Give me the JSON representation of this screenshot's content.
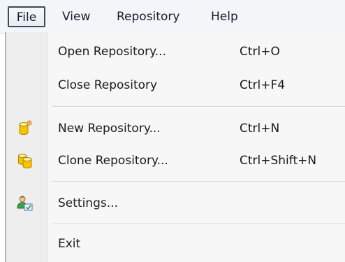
{
  "menubar": {
    "items": [
      {
        "label": "File"
      },
      {
        "label": "View"
      },
      {
        "label": "Repository"
      },
      {
        "label": "Help"
      }
    ]
  },
  "file_menu": {
    "items": [
      {
        "label": "Open Repository...",
        "shortcut": "Ctrl+O",
        "icon": null
      },
      {
        "label": "Close Repository",
        "shortcut": "Ctrl+F4",
        "icon": null
      },
      {
        "label": "New Repository...",
        "shortcut": "Ctrl+N",
        "icon": "new-repository-icon"
      },
      {
        "label": "Clone Repository...",
        "shortcut": "Ctrl+Shift+N",
        "icon": "clone-repository-icon"
      },
      {
        "label": "Settings...",
        "shortcut": "",
        "icon": "settings-user-icon"
      },
      {
        "label": "Exit",
        "shortcut": "",
        "icon": null
      }
    ]
  },
  "colors": {
    "menubar_bg": "#f3f6f9",
    "menu_bg": "#f7f7f7",
    "icon_gutter": "#eeeeee",
    "separator": "#d4d4d4",
    "text": "#1a1a1a",
    "database_yellow": "#f5c400"
  }
}
